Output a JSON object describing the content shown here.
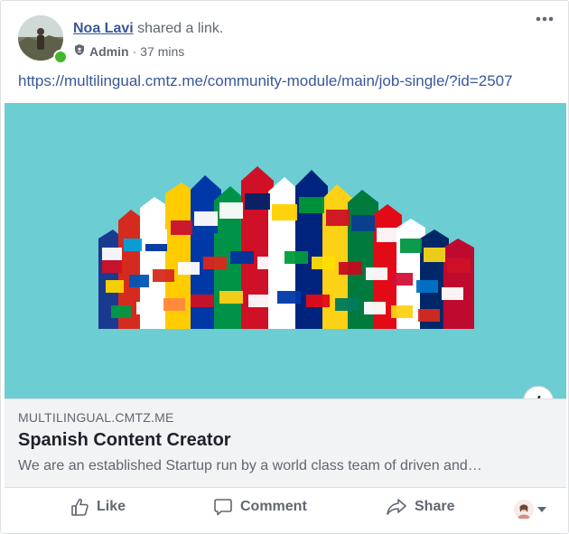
{
  "post": {
    "author_name": "Noa Lavi",
    "action_text": " shared a link.",
    "role": "Admin",
    "separator": "·",
    "time": "37 mins",
    "link_url": "https://multilingual.cmtz.me/community-module/main/job-single/?id=2507"
  },
  "preview": {
    "domain": "MULTILINGUAL.CMTZ.ME",
    "title": "Spanish Content Creator",
    "description": "We are an established Startup run by a world class team of driven and…",
    "info_icon": "i",
    "image_bg": "#6ccdd3"
  },
  "actions": {
    "like": "Like",
    "comment": "Comment",
    "share": "Share"
  },
  "icons": {
    "more": "more-horizontal-icon",
    "admin": "admin-shield-icon",
    "like": "thumbs-up-icon",
    "comment": "speech-bubble-icon",
    "share": "share-arrow-icon",
    "reactor": "profile-avatar-icon",
    "dropdown": "caret-down-icon"
  },
  "colors": {
    "link": "#385898",
    "secondary_text": "#606770",
    "online": "#42b72a"
  }
}
